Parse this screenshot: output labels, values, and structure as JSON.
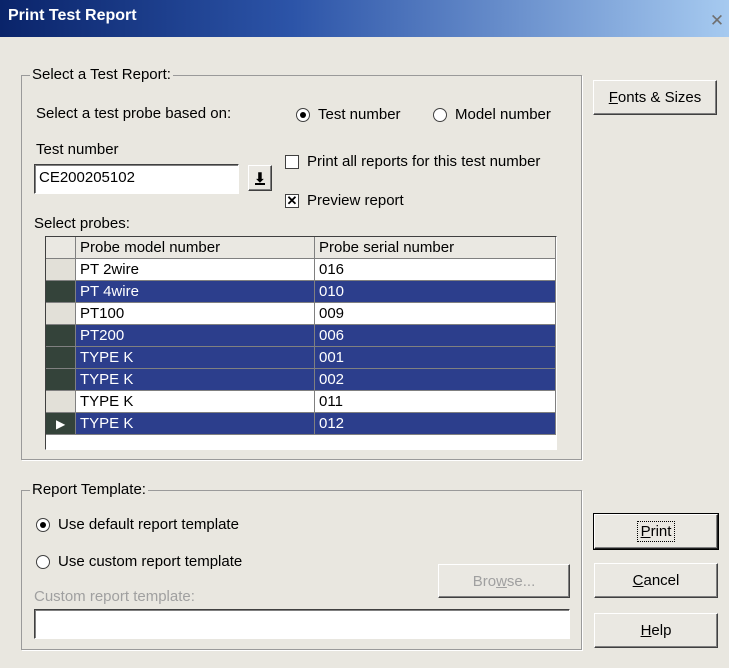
{
  "window": {
    "title": "Print Test Report"
  },
  "select_group": {
    "legend": "Select a Test Report:",
    "based_on_label": "Select a test probe based on:",
    "radio_test_number": "Test number",
    "radio_model_number": "Model number",
    "test_number_label": "Test number",
    "test_number_value": "CE200205102",
    "print_all_label": "Print all reports for this test number",
    "preview_label": "Preview report",
    "select_probes_label": "Select probes:"
  },
  "probe_grid": {
    "col_model": "Probe model number",
    "col_serial": "Probe serial number",
    "rows": [
      {
        "model": "PT 2wire",
        "serial": "016"
      },
      {
        "model": "PT 4wire",
        "serial": "010"
      },
      {
        "model": "PT100",
        "serial": "009"
      },
      {
        "model": "PT200",
        "serial": "006"
      },
      {
        "model": "TYPE K",
        "serial": "001"
      },
      {
        "model": "TYPE K",
        "serial": "002"
      },
      {
        "model": "TYPE K",
        "serial": "011"
      },
      {
        "model": "TYPE K",
        "serial": "012"
      }
    ]
  },
  "template_group": {
    "legend": "Report Template:",
    "radio_default": "Use default report template",
    "radio_custom": "Use custom report template",
    "custom_label": "Custom report template:",
    "custom_value": "",
    "browse_pre": "Bro",
    "browse_u": "w",
    "browse_post": "se..."
  },
  "buttons": {
    "fonts_u": "F",
    "fonts_rest": "onts & Sizes",
    "print_u": "P",
    "print_rest": "rint",
    "cancel_u": "C",
    "cancel_rest": "ancel",
    "help_u": "H",
    "help_rest": "elp"
  }
}
